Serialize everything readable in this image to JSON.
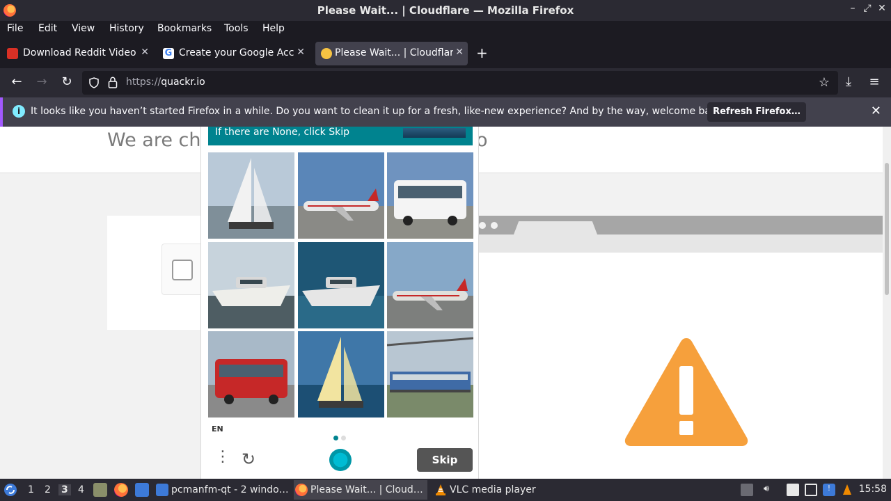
{
  "window": {
    "title": "Please Wait... | Cloudflare — Mozilla Firefox"
  },
  "menu": [
    "File",
    "Edit",
    "View",
    "History",
    "Bookmarks",
    "Tools",
    "Help"
  ],
  "tabs": [
    {
      "label": "Download Reddit Videos",
      "favicon_color": "#d93025"
    },
    {
      "label": "Create your Google Acco",
      "favicon_color": "#ffffff"
    },
    {
      "label": "Please Wait... | Cloudflare",
      "favicon_color": "#f6c343"
    }
  ],
  "nav": {
    "url_protocol": "https://",
    "url_host": "quackr.io"
  },
  "notification": {
    "message": "It looks like you haven’t started Firefox in a while. Do you want to clean it up for a fresh, like-new experience? And by the way, welcome back!",
    "button": "Refresh Firefox…"
  },
  "page": {
    "heading_left": "We are ch",
    "heading_right": "o"
  },
  "captcha": {
    "prompt": "If there are None, click Skip",
    "language": "EN",
    "skip_label": "Skip",
    "images": [
      {
        "subject": "sailboat",
        "sky": "#b9c9d8",
        "ground": "#7f8f99",
        "obj": "#f2f2f2"
      },
      {
        "subject": "airplane",
        "sky": "#5a86b8",
        "ground": "#8a8a86",
        "obj": "#e8e8e8"
      },
      {
        "subject": "bus",
        "sky": "#6f93bf",
        "ground": "#8f8f88",
        "obj": "#f4f4f4"
      },
      {
        "subject": "motorboat",
        "sky": "#c7d3dc",
        "ground": "#4e5d63",
        "obj": "#eeeeea"
      },
      {
        "subject": "speedboat",
        "sky": "#1e5675",
        "ground": "#2a6a88",
        "obj": "#e6e6e6"
      },
      {
        "subject": "airplane",
        "sky": "#86a8c8",
        "ground": "#7d7f7d",
        "obj": "#e0e0dc"
      },
      {
        "subject": "bus",
        "sky": "#a8b9c8",
        "ground": "#8a8a8a",
        "obj": "#c62828"
      },
      {
        "subject": "sailboat",
        "sky": "#3f77a8",
        "ground": "#1c4f74",
        "obj": "#f2e4a0"
      },
      {
        "subject": "train",
        "sky": "#b8c6d2",
        "ground": "#7a8a6a",
        "obj": "#3f6ba6"
      }
    ],
    "page_dots": [
      "#00838f",
      "#dddddd"
    ]
  },
  "taskbar": {
    "workspaces": [
      "1",
      "2",
      "3",
      "4"
    ],
    "current_workspace": "3",
    "tasks": [
      {
        "label": "pcmanfm-qt - 2 windo…",
        "icon_color": "#3d7ad8"
      },
      {
        "label": "Please Wait... | Cloud…",
        "icon_color": "#ff7139"
      },
      {
        "label": "VLC media player",
        "icon_color": "#f08a00"
      }
    ],
    "clock": "15:58"
  }
}
